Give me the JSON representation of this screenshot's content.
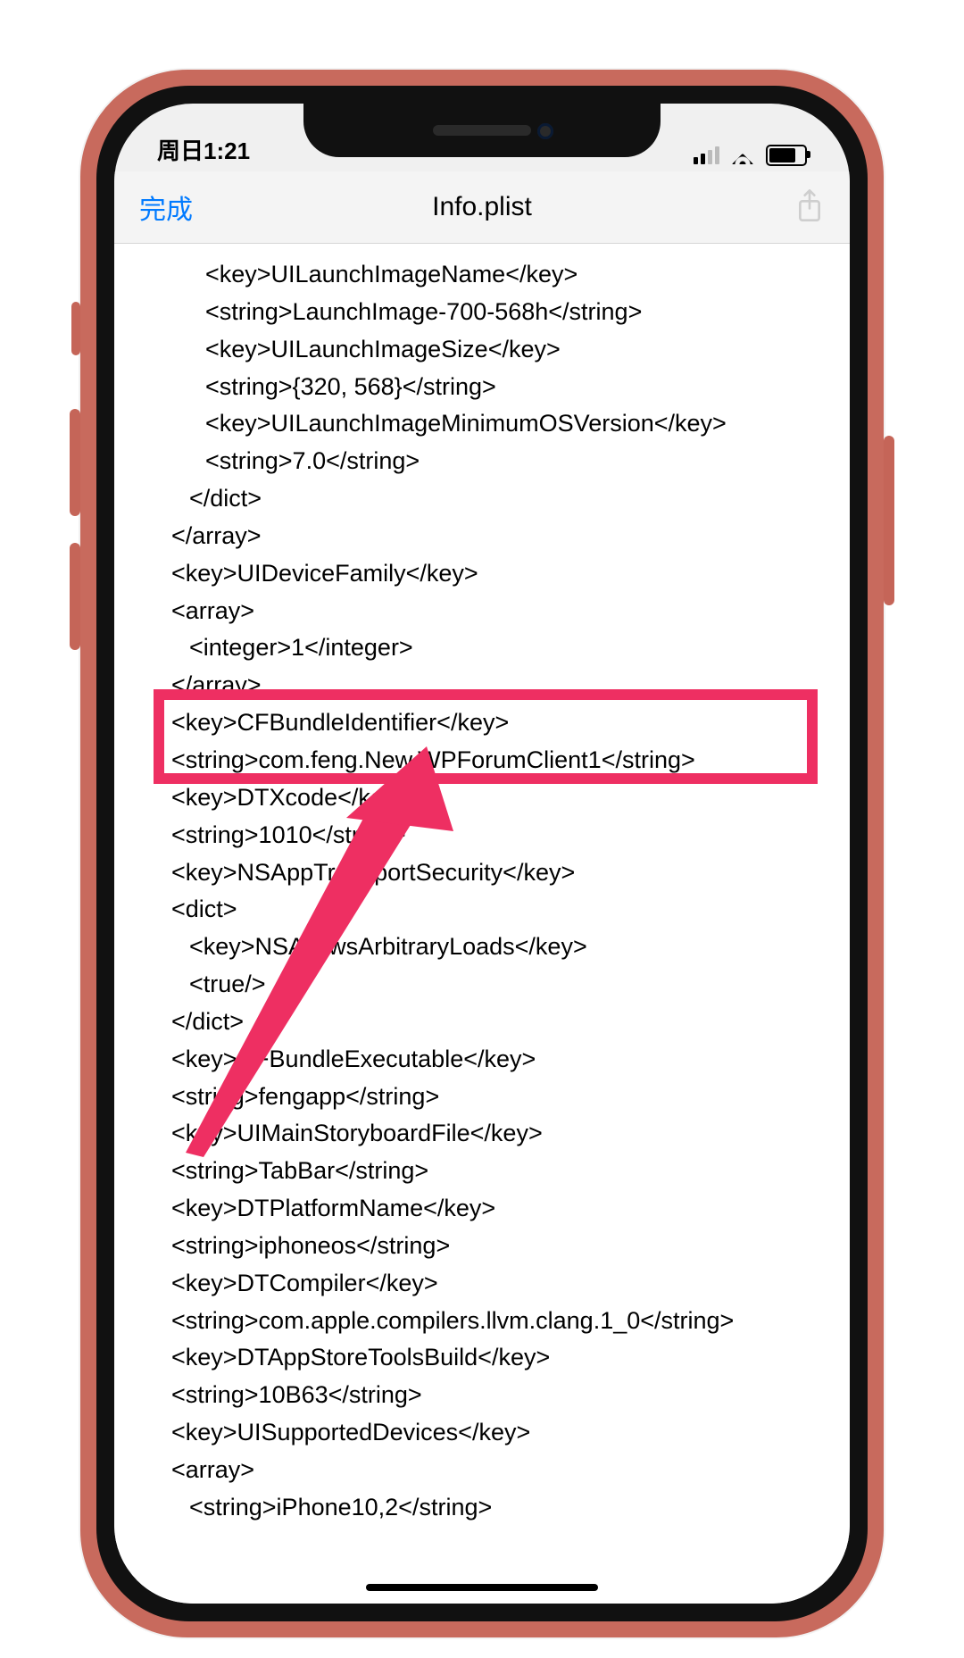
{
  "status": {
    "time": "周日1:21"
  },
  "nav": {
    "done_label": "完成",
    "title": "Info.plist"
  },
  "plist": {
    "lines": [
      {
        "cls": "ind2",
        "t": "<key>UILaunchImageName</key>"
      },
      {
        "cls": "ind2",
        "t": "<string>LaunchImage-700-568h</string>"
      },
      {
        "cls": "ind2",
        "t": "<key>UILaunchImageSize</key>"
      },
      {
        "cls": "ind2",
        "t": "<string>{320, 568}</string>"
      },
      {
        "cls": "ind2",
        "t": "<key>UILaunchImageMinimumOSVersion</key>"
      },
      {
        "cls": "ind2",
        "t": "<string>7.0</string>"
      },
      {
        "cls": "ind1",
        "t": "</dict>"
      },
      {
        "cls": "ind0b",
        "t": "</array>"
      },
      {
        "cls": "ind0b",
        "t": "<key>UIDeviceFamily</key>"
      },
      {
        "cls": "ind0b",
        "t": "<array>"
      },
      {
        "cls": "ind1",
        "t": "<integer>1</integer>"
      },
      {
        "cls": "ind0b",
        "t": "</array>"
      },
      {
        "cls": "ind0b",
        "t": "<key>CFBundleIdentifier</key>"
      },
      {
        "cls": "ind0b",
        "t": "<string>com.feng.New.WPForumClient1</string>"
      },
      {
        "cls": "ind0b",
        "t": "<key>DTXcode</key>"
      },
      {
        "cls": "ind0b",
        "t": "<string>1010</string>"
      },
      {
        "cls": "ind0b",
        "t": "<key>NSAppTransportSecurity</key>"
      },
      {
        "cls": "ind0b",
        "t": "<dict>"
      },
      {
        "cls": "ind1",
        "t": "<key>NSAllowsArbitraryLoads</key>"
      },
      {
        "cls": "ind1",
        "t": "<true/>"
      },
      {
        "cls": "ind0b",
        "t": "</dict>"
      },
      {
        "cls": "ind0b",
        "t": "<key>CFBundleExecutable</key>"
      },
      {
        "cls": "ind0b",
        "t": "<string>fengapp</string>"
      },
      {
        "cls": "ind0b",
        "t": "<key>UIMainStoryboardFile</key>"
      },
      {
        "cls": "ind0b",
        "t": "<string>TabBar</string>"
      },
      {
        "cls": "ind0b",
        "t": "<key>DTPlatformName</key>"
      },
      {
        "cls": "ind0b",
        "t": "<string>iphoneos</string>"
      },
      {
        "cls": "ind0b",
        "t": "<key>DTCompiler</key>"
      },
      {
        "cls": "ind0b",
        "t": "<string>com.apple.compilers.llvm.clang.1_0</string>"
      },
      {
        "cls": "ind0b",
        "t": "<key>DTAppStoreToolsBuild</key>"
      },
      {
        "cls": "ind0b",
        "t": "<string>10B63</string>"
      },
      {
        "cls": "ind0b",
        "t": "<key>UISupportedDevices</key>"
      },
      {
        "cls": "ind0b",
        "t": "<array>"
      },
      {
        "cls": "ind1",
        "t": "<string>iPhone10,2</string>"
      }
    ]
  },
  "annotation": {
    "highlight_color": "#ee2f62",
    "highlighted_key": "CFBundleIdentifier",
    "highlighted_value": "com.feng.New.WPForumClient1"
  }
}
